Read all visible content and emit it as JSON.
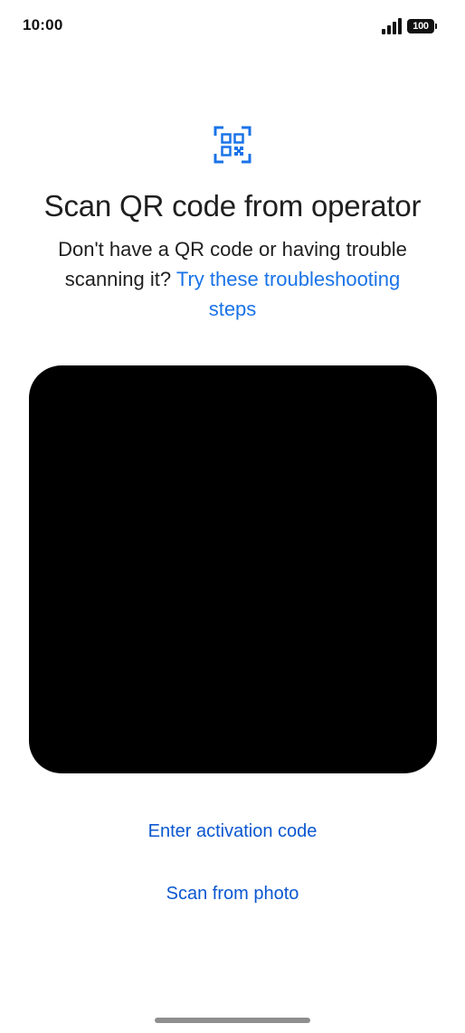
{
  "status_bar": {
    "time": "10:00",
    "battery_level": "100",
    "signal_icon": "signal-bars-icon"
  },
  "header": {
    "icon": "qr-code-scanner-icon",
    "icon_color": "#1a73e8",
    "title": "Scan QR code from operator",
    "subtitle_text": "Don't have a QR code or having trouble scanning it?",
    "subtitle_link": "Try these troubleshooting steps"
  },
  "actions": {
    "enter_code": "Enter activation code",
    "scan_photo": "Scan from photo"
  },
  "colors": {
    "link": "#1a73e8",
    "button_text": "#0b57d0",
    "viewfinder": "#000000"
  }
}
